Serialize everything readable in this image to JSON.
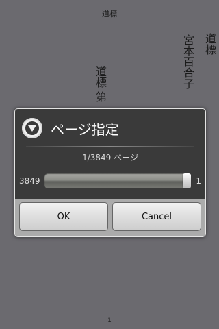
{
  "reader": {
    "header": "道標",
    "book_title": "道標",
    "author": "宮本百合子",
    "chapter_heading": "道標 第",
    "page_footer": "1"
  },
  "dialog": {
    "icon": "chevron-down-circle-icon",
    "title": "ページ指定",
    "page_indicator": "1/3849 ページ",
    "slider": {
      "min_label": "3849",
      "max_label": "1",
      "value_fraction": 1.0
    },
    "ok_label": "OK",
    "cancel_label": "Cancel"
  }
}
